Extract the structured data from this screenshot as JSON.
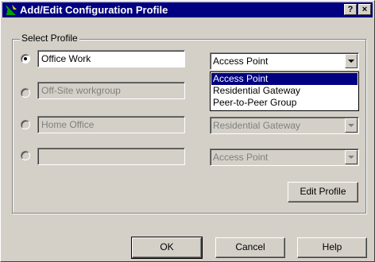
{
  "window": {
    "title": "Add/Edit Configuration Profile",
    "help_button": "?",
    "close_button": "×"
  },
  "group": {
    "label": "Select Profile"
  },
  "profiles": [
    {
      "name": "Office Work",
      "type": "Access Point",
      "selected": true,
      "enabled": true
    },
    {
      "name": "Off-Site workgroup",
      "type": "",
      "selected": false,
      "enabled": false
    },
    {
      "name": "Home Office",
      "type": "Residential Gateway",
      "selected": false,
      "enabled": false
    },
    {
      "name": "",
      "type": "Access Point",
      "selected": false,
      "enabled": false
    }
  ],
  "dropdown": {
    "options": [
      "Access Point",
      "Residential Gateway",
      "Peer-to-Peer Group"
    ],
    "highlighted": "Access Point"
  },
  "buttons": {
    "edit_profile": "Edit Profile",
    "ok": "OK",
    "cancel": "Cancel",
    "help": "Help"
  },
  "colors": {
    "titlebar": "#000080",
    "dialog_face": "#d4d0c8",
    "highlight": "#000080"
  }
}
